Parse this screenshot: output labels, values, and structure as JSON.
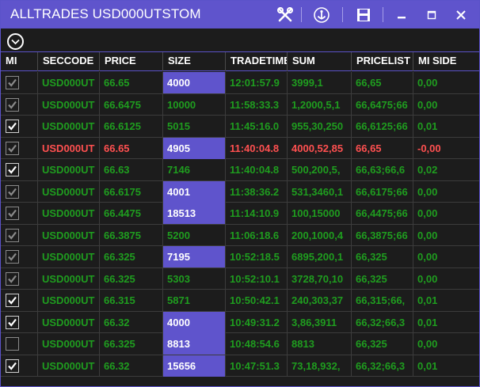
{
  "window": {
    "title": "ALLTRADES USD000UTSTOM"
  },
  "icons": {
    "tools": "tools-icon",
    "anchor": "anchor-icon",
    "save": "save-icon",
    "minimize": "minimize-icon",
    "maximize": "maximize-icon",
    "close": "close-icon",
    "expand": "chevron-down-circle-icon"
  },
  "columns": [
    "MI",
    "SECCODE",
    "PRICE",
    "SIZE",
    "TRADETIME",
    "SUM",
    "PRICELIST",
    "MI SIDE"
  ],
  "colors": {
    "accent": "#5f54cc",
    "buy": "#1f9d1f",
    "sell": "#ff5050",
    "background": "#1c1c1c"
  },
  "rows": [
    {
      "checked": "dim",
      "seccode": "USD000UT",
      "price": "66.65",
      "size": "4000",
      "size_hl": true,
      "time": "12:01:57.9",
      "sum": "3999,1",
      "pricelist": "66,65",
      "side": "0,00",
      "color": "green"
    },
    {
      "checked": "dim",
      "seccode": "USD000UT",
      "price": "66.6475",
      "size": "10000",
      "size_hl": false,
      "time": "11:58:33.3",
      "sum": "1,2000,5,1",
      "pricelist": "66,6475;66",
      "side": "0,00",
      "color": "green"
    },
    {
      "checked": "bright",
      "seccode": "USD000UT",
      "price": "66.6125",
      "size": "5015",
      "size_hl": false,
      "time": "11:45:16.0",
      "sum": "955,30,250",
      "pricelist": "66,6125;66",
      "side": "0,01",
      "color": "green"
    },
    {
      "checked": "dim",
      "seccode": "USD000UT",
      "price": "66.65",
      "size": "4905",
      "size_hl": true,
      "time": "11:40:04.8",
      "sum": "4000,52,85",
      "pricelist": "66,65",
      "side": "-0,00",
      "color": "red"
    },
    {
      "checked": "bright",
      "seccode": "USD000UT",
      "price": "66.63",
      "size": "7146",
      "size_hl": false,
      "time": "11:40:04.8",
      "sum": "500,200,5,",
      "pricelist": "66,63;66,6",
      "side": "0,02",
      "color": "green"
    },
    {
      "checked": "dim",
      "seccode": "USD000UT",
      "price": "66.6175",
      "size": "4001",
      "size_hl": true,
      "time": "11:38:36.2",
      "sum": "531,3460,1",
      "pricelist": "66,6175;66",
      "side": "0,00",
      "color": "green"
    },
    {
      "checked": "dim",
      "seccode": "USD000UT",
      "price": "66.4475",
      "size": "18513",
      "size_hl": true,
      "time": "11:14:10.9",
      "sum": "100,15000",
      "pricelist": "66,4475;66",
      "side": "0,00",
      "color": "green"
    },
    {
      "checked": "dim",
      "seccode": "USD000UT",
      "price": "66.3875",
      "size": "5200",
      "size_hl": false,
      "time": "11:06:18.6",
      "sum": "200,1000,4",
      "pricelist": "66,3875;66",
      "side": "0,00",
      "color": "green"
    },
    {
      "checked": "dim",
      "seccode": "USD000UT",
      "price": "66.325",
      "size": "7195",
      "size_hl": true,
      "time": "10:52:18.5",
      "sum": "6895,200,1",
      "pricelist": "66,325",
      "side": "0,00",
      "color": "green"
    },
    {
      "checked": "dim",
      "seccode": "USD000UT",
      "price": "66.325",
      "size": "5303",
      "size_hl": false,
      "time": "10:52:10.1",
      "sum": "3728,70,10",
      "pricelist": "66,325",
      "side": "0,00",
      "color": "green"
    },
    {
      "checked": "bright",
      "seccode": "USD000UT",
      "price": "66.315",
      "size": "5871",
      "size_hl": false,
      "time": "10:50:42.1",
      "sum": "240,303,37",
      "pricelist": "66,315;66,",
      "side": "0,01",
      "color": "green"
    },
    {
      "checked": "bright",
      "seccode": "USD000UT",
      "price": "66.32",
      "size": "4000",
      "size_hl": true,
      "time": "10:49:31.2",
      "sum": "3,86,3911",
      "pricelist": "66,32;66,3",
      "side": "0,01",
      "color": "green"
    },
    {
      "checked": "none",
      "seccode": "USD000UT",
      "price": "66.325",
      "size": "8813",
      "size_hl": true,
      "time": "10:48:54.6",
      "sum": "8813",
      "pricelist": "66,325",
      "side": "0,00",
      "color": "green"
    },
    {
      "checked": "bright",
      "seccode": "USD000UT",
      "price": "66.32",
      "size": "15656",
      "size_hl": true,
      "time": "10:47:51.3",
      "sum": "73,18,932,",
      "pricelist": "66,32;66,3",
      "side": "0,01",
      "color": "green"
    }
  ]
}
